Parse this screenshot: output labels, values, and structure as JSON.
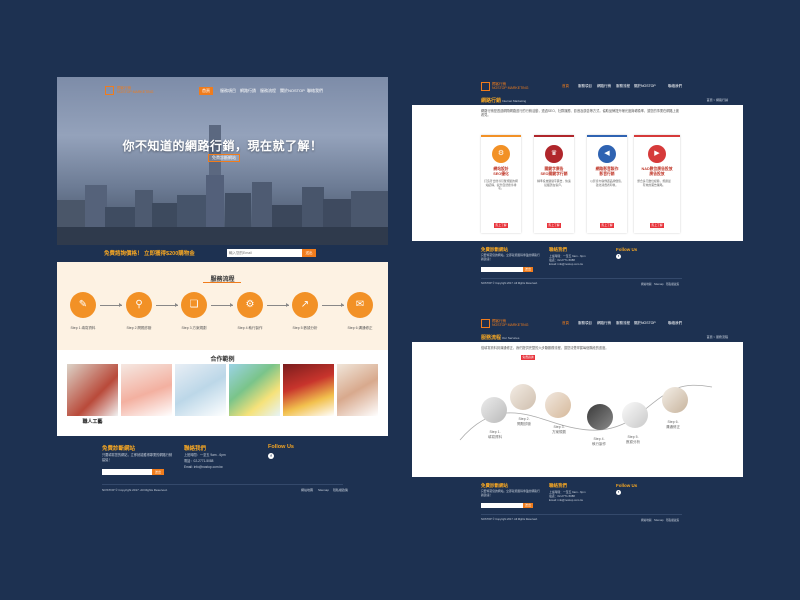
{
  "left_page": {
    "logo": {
      "line1": "獨客行銷",
      "line2": "NOSTOP MARKETING"
    },
    "nav": [
      "首頁",
      "服務項目",
      "網路行銷",
      "服務流程",
      "關於NOSTOP",
      "聯絡我們"
    ],
    "hero_title": "你不知道的網路行銷，現在就了解！",
    "hero_button": "免費診斷網站",
    "bar_text": "免費諮詢價格！ 立即獲得$200購物金",
    "bar_placeholder": "輸入您的Email",
    "bar_button": "送出",
    "steps_title": "服務流程",
    "steps": [
      {
        "icon": "✎",
        "label": "Step 1.填寫資料"
      },
      {
        "icon": "⚲",
        "label": "Step 2.問題診斷"
      },
      {
        "icon": "❏",
        "label": "Step 3.方案規劃"
      },
      {
        "icon": "⚙",
        "label": "Step 4.執行製作"
      },
      {
        "icon": "↗",
        "label": "Step 5.數據分析"
      },
      {
        "icon": "✉",
        "label": "Step 6.溝通修正"
      }
    ],
    "works_title": "合作範例",
    "works_logos": [
      "職人工藝",
      "",
      "",
      "",
      "",
      ""
    ],
    "footer": {
      "col1_title": "免費診斷網站",
      "col1_text": "只要填寫您的網站，立即就能獲得專業的網路行銷建議！",
      "col1_placeholder": "輸入您的Email",
      "col1_button": "送出",
      "col2_title": "聯絡我們",
      "col2_lines": [
        "上班時間：一至五 9am - 6pm",
        "電話：02-2771-5088",
        "Email: info@nostop.com.tw"
      ],
      "col3_title": "Follow Us",
      "fb": "f",
      "copyright": "NOSTOP © Copyright 2017. All Rights Reserved.",
      "links": [
        "網站地圖",
        "Sitemap",
        "隱私權政策"
      ]
    }
  },
  "right_top": {
    "nav": [
      "首頁",
      "服務項目",
      "網路行銷",
      "服務流程",
      "關於NOSTOP",
      "聯絡我們"
    ],
    "heading": "網路行銷",
    "heading_en": "Internet Marketing",
    "breadcrumb": "首頁 > 網路行銷",
    "intro": "網路行銷是透過網際網路進行的行銷活動，透過SEO、社群媒體、影音及廣告等方式，協助品牌提升曝光度與轉換率，讓您的事業在網路上被看見。",
    "cards": [
      {
        "title": "網站設計\nSEO優化",
        "desc": "打造符合搜尋引擎規範的網站結構，提升自然搜尋排名。",
        "button": "馬上了解",
        "color": "#f29126"
      },
      {
        "title": "關鍵字廣告\nSEO關鍵字行銷",
        "desc": "精準投放關鍵字廣告，快速接觸潛在客戶。",
        "button": "馬上了解",
        "color": "#b0262b"
      },
      {
        "title": "網路影音製作\n影音行銷",
        "desc": "以影音內容傳遞品牌價值，強化消費者印象。",
        "button": "馬上了解",
        "color": "#2f63b2"
      },
      {
        "title": "NAD數位廣告投放\n廣告投放",
        "desc": "整合多元數位媒體，規劃最有效的廣告策略。",
        "button": "馬上了解",
        "color": "#d63a3a"
      }
    ],
    "footer": {
      "col1_title": "免費診斷網站",
      "col2_title": "聯絡我們",
      "col3_title": "Follow Us",
      "copyright": "NOSTOP © Copyright 2017. All Rights Reserved."
    }
  },
  "right_bottom": {
    "nav": [
      "首頁",
      "服務項目",
      "網路行銷",
      "服務流程",
      "關於NOSTOP",
      "聯絡我們"
    ],
    "heading": "服務流程",
    "heading_en": "Our Services",
    "breadcrumb": "首頁 > 服務流程",
    "intro": "從填寫資料到溝通修正，我們提供完整的六步驟服務流程，讓您清楚掌握每個階段的進度。",
    "intro_button": "免費諮詢",
    "process": [
      "Step 1.\n填寫資料",
      "Step 2.\n問題診斷",
      "Step 3.\n方案規劃",
      "Step 4.\n執行製作",
      "Step 5.\n數據分析",
      "Step 6.\n溝通修正"
    ],
    "footer": {
      "col1_title": "免費診斷網站",
      "col2_title": "聯絡我們",
      "col3_title": "Follow Us",
      "copyright": "NOSTOP © Copyright 2017. All Rights Reserved."
    }
  }
}
